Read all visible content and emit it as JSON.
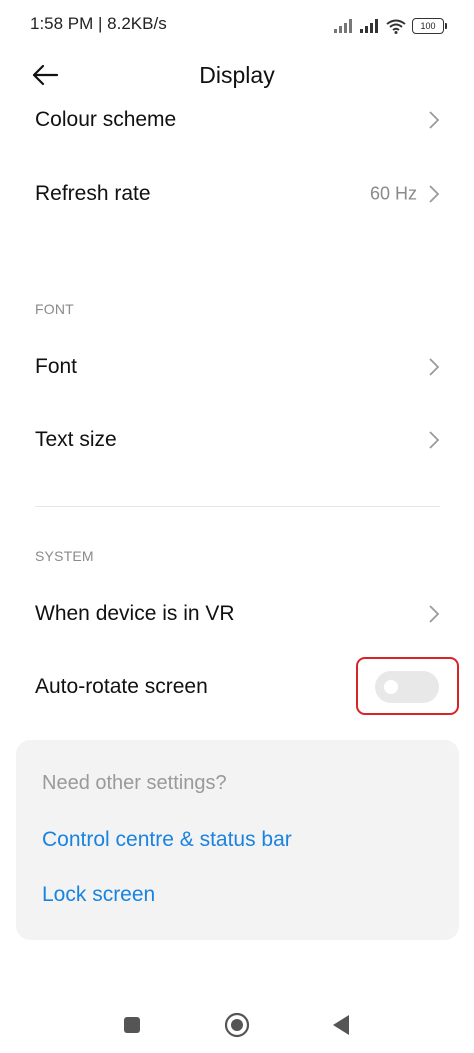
{
  "status_bar": {
    "time_speed": "1:58 PM | 8.2KB/s",
    "battery": "100",
    "icons": [
      "signal-icon",
      "signal-icon",
      "wifi-icon",
      "battery-icon"
    ]
  },
  "header": {
    "title": "Display",
    "back_icon": "arrow-left-icon"
  },
  "rows": {
    "colour_scheme": "Colour scheme",
    "refresh_rate": "Refresh rate",
    "refresh_rate_value": "60 Hz",
    "font": "Font",
    "text_size": "Text size",
    "vr": "When device is in VR",
    "auto_rotate": "Auto-rotate screen"
  },
  "sections": {
    "font": "FONT",
    "system": "SYSTEM"
  },
  "auto_rotate_toggle": {
    "state": "off"
  },
  "card": {
    "title": "Need other settings?",
    "link_control_centre": "Control centre & status bar",
    "link_lock_screen": "Lock screen"
  },
  "colors": {
    "accent_link": "#1a83e0",
    "highlight": "#d9232b",
    "toggle_off": "#e8e8e8"
  },
  "nav_bar": {
    "icons": [
      "recents-square-icon",
      "home-circle-icon",
      "back-triangle-icon"
    ]
  }
}
